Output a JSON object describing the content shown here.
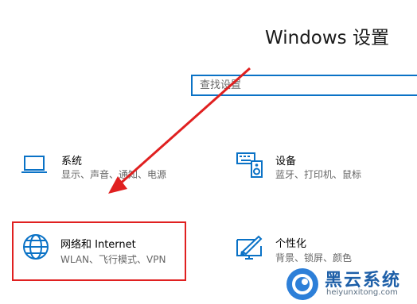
{
  "header": {
    "title": "Windows 设置"
  },
  "search": {
    "placeholder": "查找设置"
  },
  "tiles": [
    {
      "title": "系统",
      "desc": "显示、声音、通知、电源",
      "icon": "laptop-icon"
    },
    {
      "title": "设备",
      "desc": "蓝牙、打印机、鼠标",
      "icon": "keyboard-speaker-icon"
    },
    {
      "title": "网络和 Internet",
      "desc": "WLAN、飞行模式、VPN",
      "icon": "globe-icon"
    },
    {
      "title": "个性化",
      "desc": "背景、锁屏、颜色",
      "icon": "paint-monitor-icon"
    }
  ],
  "watermark": {
    "text": "黑云系统",
    "url": "heiyunxitong.com"
  },
  "colors": {
    "accent": "#0a72c6",
    "highlight": "#e02020",
    "watermark": "#1d5fa8"
  }
}
